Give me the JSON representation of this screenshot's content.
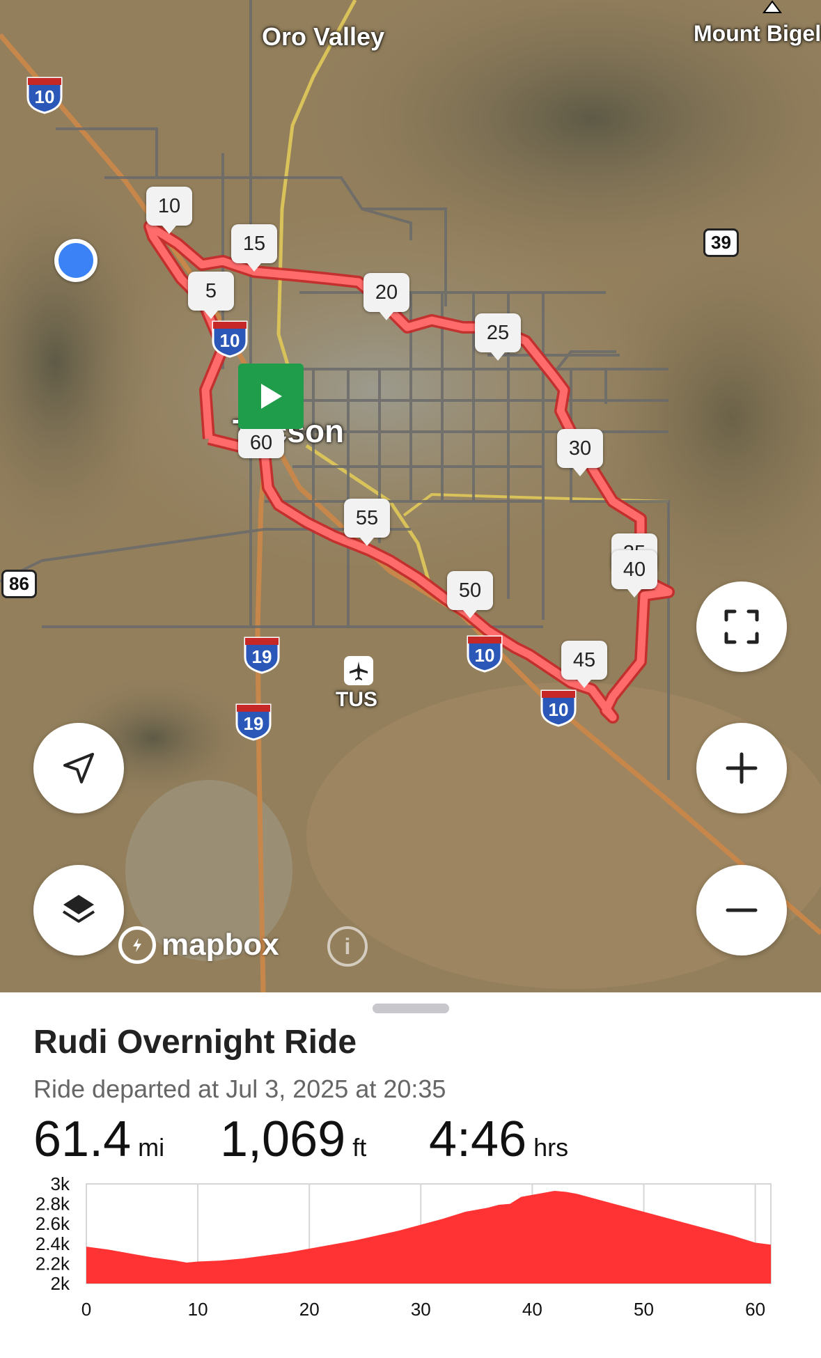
{
  "map": {
    "labels": {
      "oro_valley": "Oro Valley",
      "mount_bigelow": "Mount Bigel",
      "tucson": "Tucson",
      "airport_code": "TUS"
    },
    "interstate_shields": [
      "10",
      "10",
      "10",
      "10",
      "19",
      "19"
    ],
    "route_shields": [
      "39",
      "86"
    ],
    "km_markers": [
      "5",
      "10",
      "15",
      "20",
      "25",
      "30",
      "35",
      "40",
      "45",
      "50",
      "55",
      "60"
    ],
    "attribution": "mapbox",
    "attribution_info": "i"
  },
  "controls": {
    "fullscreen_icon": "fullscreen-icon",
    "zoom_in_icon": "plus-icon",
    "zoom_out_icon": "minus-icon",
    "locate_icon": "navigation-arrow-icon",
    "layers_icon": "layers-icon"
  },
  "ride": {
    "title": "Rudi Overnight Ride",
    "subtitle": "Ride departed at Jul 3, 2025 at 20:35",
    "distance_value": "61.4",
    "distance_unit": "mi",
    "elevation_value": "1,069",
    "elevation_unit": "ft",
    "duration_value": "4:46",
    "duration_unit": "hrs"
  },
  "colors": {
    "route": "#ff4d4d",
    "start": "#1f9d4b",
    "profile_fill": "#ff3333",
    "location": "#3b82f6"
  },
  "chart_data": {
    "type": "area",
    "x_ticks": [
      "0",
      "10",
      "20",
      "30",
      "40",
      "50",
      "60"
    ],
    "y_ticks": [
      "2k",
      "2.2k",
      "2.4k",
      "2.6k",
      "2.8k",
      "3k"
    ],
    "xlim": [
      0,
      61.4
    ],
    "ylim": [
      2000,
      3000
    ],
    "x": [
      0,
      2,
      4,
      6,
      8,
      9,
      10,
      12,
      14,
      16,
      18,
      20,
      22,
      24,
      26,
      28,
      30,
      32,
      34,
      36,
      37,
      38,
      39,
      40,
      41,
      42,
      43,
      44,
      46,
      48,
      50,
      52,
      54,
      56,
      58,
      60,
      61.4
    ],
    "y": [
      2370,
      2340,
      2300,
      2260,
      2230,
      2210,
      2220,
      2230,
      2250,
      2280,
      2310,
      2350,
      2390,
      2430,
      2480,
      2530,
      2590,
      2650,
      2720,
      2760,
      2790,
      2800,
      2870,
      2890,
      2910,
      2930,
      2920,
      2900,
      2840,
      2780,
      2720,
      2660,
      2600,
      2540,
      2480,
      2410,
      2390
    ]
  }
}
